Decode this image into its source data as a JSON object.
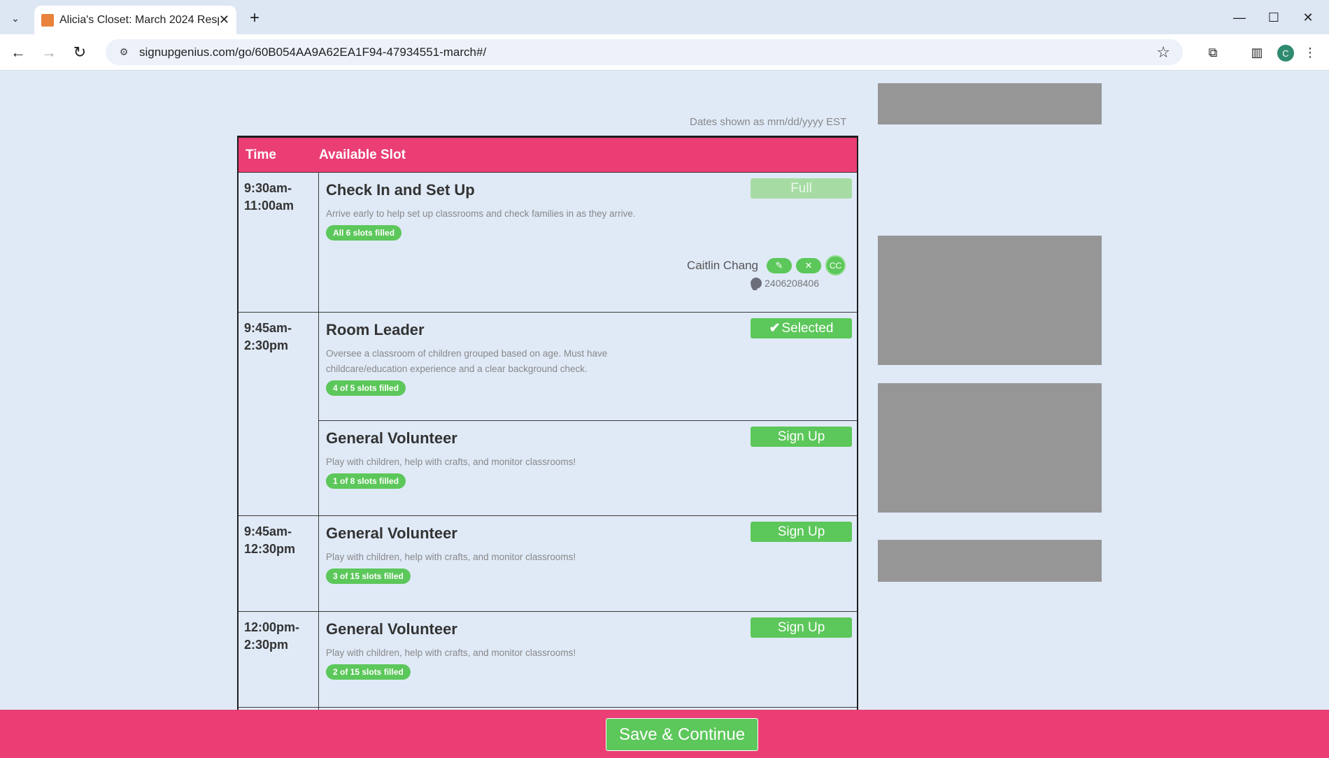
{
  "browser": {
    "tab_title": "Alicia's Closet: March 2024 Resp",
    "url": "signupgenius.com/go/60B054AA9A62EA1F94-47934551-march#/",
    "profile_initial": "C"
  },
  "page": {
    "dates_note": "Dates shown as mm/dd/yyyy EST",
    "table_header": {
      "time": "Time",
      "slot": "Available Slot"
    },
    "rows": [
      {
        "time": "9:30am-\n11:00am",
        "slots": [
          {
            "title": "Check In and Set Up",
            "description": "Arrive early to help set up classrooms and check families in as they arrive.",
            "badge": "All 6 slots filled",
            "button": "Full",
            "volunteer": {
              "name": "Caitlin Chang",
              "initials": "CC",
              "phone": "2406208406"
            }
          }
        ]
      },
      {
        "time": "9:45am-\n2:30pm",
        "slots": [
          {
            "title": "Room Leader",
            "description": "Oversee a classroom of children grouped based on age. Must have childcare/education experience and a clear background check.",
            "badge": "4 of 5 slots filled",
            "button": "Selected"
          },
          {
            "title": "General Volunteer",
            "description": "Play with children, help with crafts, and monitor classrooms!",
            "badge": "1 of 8 slots filled",
            "button": "Sign Up"
          }
        ]
      },
      {
        "time": "9:45am-\n12:30pm",
        "slots": [
          {
            "title": "General Volunteer",
            "description": "Play with children, help with crafts, and monitor classrooms!",
            "badge": "3 of 15 slots filled",
            "button": "Sign Up"
          }
        ]
      },
      {
        "time": "12:00pm-\n2:30pm",
        "slots": [
          {
            "title": "General Volunteer",
            "description": "Play with children, help with crafts, and monitor classrooms!",
            "badge": "2 of 15 slots filled",
            "button": "Sign Up"
          }
        ]
      }
    ],
    "save_button": "Save & Continue"
  },
  "colors": {
    "brand_pink": "#ea3e74",
    "button_green": "#5cc75a",
    "page_bg": "#e0eaf7"
  }
}
